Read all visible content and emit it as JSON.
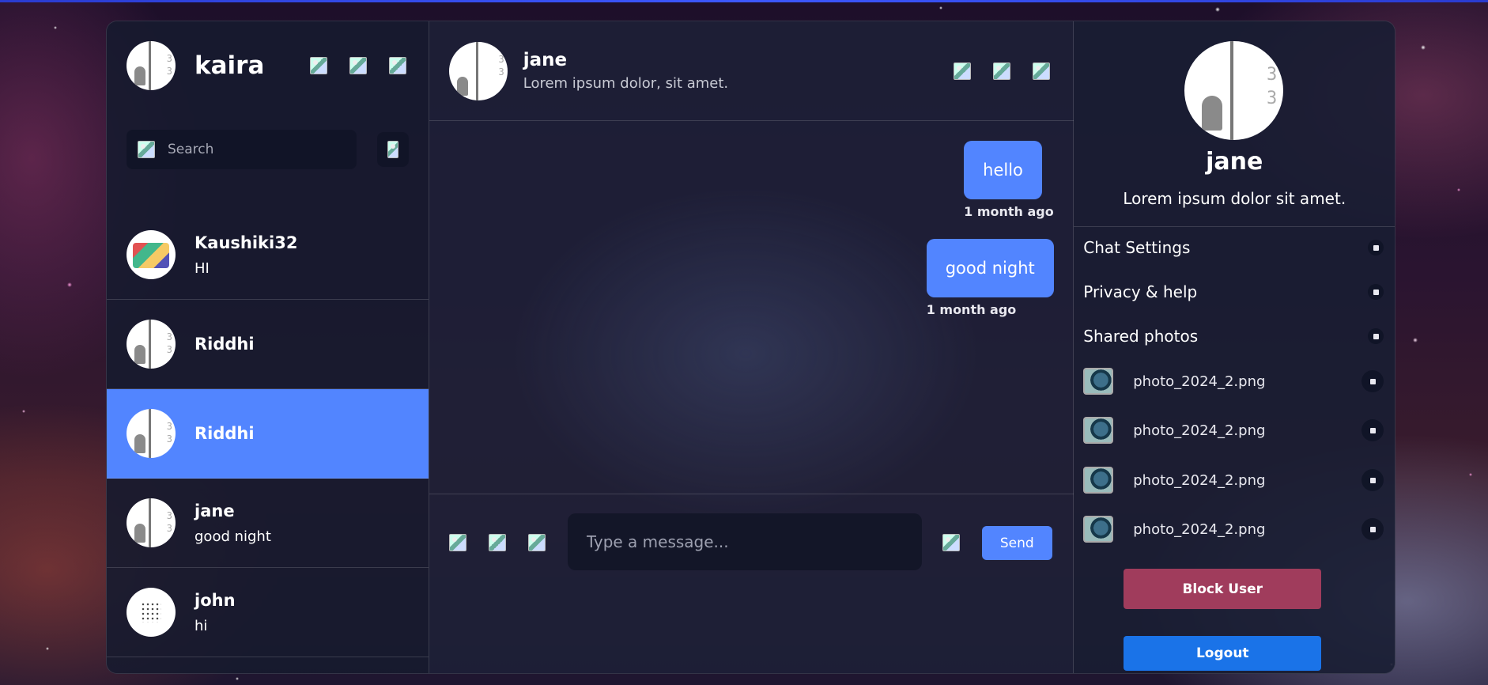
{
  "current_user": {
    "name": "kaira"
  },
  "sidebar": {
    "header_icons": [
      "more-icon",
      "video-icon",
      "edit-icon"
    ],
    "search": {
      "placeholder": "Search",
      "value": ""
    },
    "filter_icon": "plus-icon",
    "contacts": [
      {
        "name": "Kaushiki32",
        "last_message": "HI",
        "active": false
      },
      {
        "name": "Riddhi",
        "last_message": "",
        "active": false
      },
      {
        "name": "Riddhi",
        "last_message": "",
        "active": true
      },
      {
        "name": "jane",
        "last_message": "good night",
        "active": false
      },
      {
        "name": "john",
        "last_message": "hi",
        "active": false
      }
    ]
  },
  "chat": {
    "header": {
      "name": "jane",
      "status": "Lorem ipsum dolor, sit amet.",
      "icons": [
        "phone-icon",
        "video-icon",
        "info-icon"
      ]
    },
    "messages": [
      {
        "text": "hello",
        "time": "1 month ago",
        "own": true
      },
      {
        "text": "good night",
        "time": "1 month ago",
        "own": true
      }
    ],
    "composer": {
      "icons": [
        "image-icon",
        "camera-icon",
        "mic-icon"
      ],
      "placeholder": "Type a message...",
      "emoji_icon": "emoji-icon",
      "send_label": "Send"
    }
  },
  "details": {
    "name": "jane",
    "status": "Lorem ipsum dolor sit amet.",
    "options": [
      {
        "label": "Chat Settings"
      },
      {
        "label": "Privacy & help"
      },
      {
        "label": "Shared photos"
      }
    ],
    "shared_photos": [
      {
        "filename": "photo_2024_2.png"
      },
      {
        "filename": "photo_2024_2.png"
      },
      {
        "filename": "photo_2024_2.png"
      },
      {
        "filename": "photo_2024_2.png"
      }
    ],
    "block_label": "Block User",
    "logout_label": "Logout"
  },
  "colors": {
    "accent": "#5285ff",
    "block": "#a03c5c",
    "logout": "#1a73e8"
  }
}
